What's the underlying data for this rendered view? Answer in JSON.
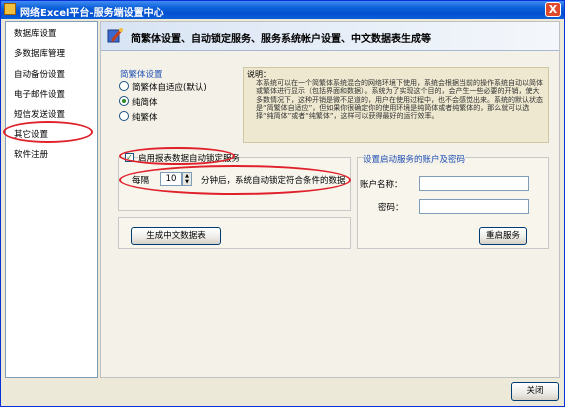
{
  "window": {
    "title": "网络Excel平台-服务端设置中心",
    "close_glyph": "X"
  },
  "sidebar": {
    "items": [
      {
        "label": "数据库设置"
      },
      {
        "label": "多数据库管理"
      },
      {
        "label": "自动备份设置"
      },
      {
        "label": "电子邮件设置"
      },
      {
        "label": "短信发送设置"
      },
      {
        "label": "其它设置",
        "selected": true
      },
      {
        "label": "软件注册"
      }
    ]
  },
  "banner": {
    "title": "简繁体设置、自动锁定服务、服务系统帐户设置、中文数据表生成等"
  },
  "charset": {
    "group_label": "简繁体设置",
    "options": [
      {
        "label": "简繁体自适应(默认)",
        "checked": false
      },
      {
        "label": "纯简体",
        "checked": true
      },
      {
        "label": "纯繁体",
        "checked": false
      }
    ]
  },
  "description": {
    "label": "说明：",
    "text": "本系统可以在一个简繁体系统混合的网络环境下使用，系统会根据当前的操作系统自动以简体或繁体进行显示（包括界面和数据）。系统为了实现这个目的，会产生一些必要的开销，使大多数情况下，这种开销是微不足道的，用户在使用过程中，也不会感觉出来。系统的默认状态是“简繁体自适应”，但如果你很确定你的使用环境是纯简体或者纯繁体的，那么就可以选择“纯简体”或者“纯繁体”，这样可以获得最好的运行效率。"
  },
  "autolock": {
    "checkbox_label": "启用报表数据自动锁定服务",
    "checked": true,
    "prefix": "每隔",
    "minutes": "10",
    "suffix": "分钟后，系统自动锁定符合条件的数据"
  },
  "generate": {
    "button_label": "生成中文数据表"
  },
  "service_account": {
    "group_label": "设置启动服务的账户及密码",
    "account_label": "账户名称：",
    "account_value": "",
    "password_label": "密码：",
    "password_value": "",
    "restart_button_label": "重启服务"
  },
  "footer": {
    "close_button_label": "关闭"
  },
  "colors": {
    "accent": "#1f4fb4",
    "annotation": "#e0202a",
    "titlebar": "#0a5fd8"
  }
}
